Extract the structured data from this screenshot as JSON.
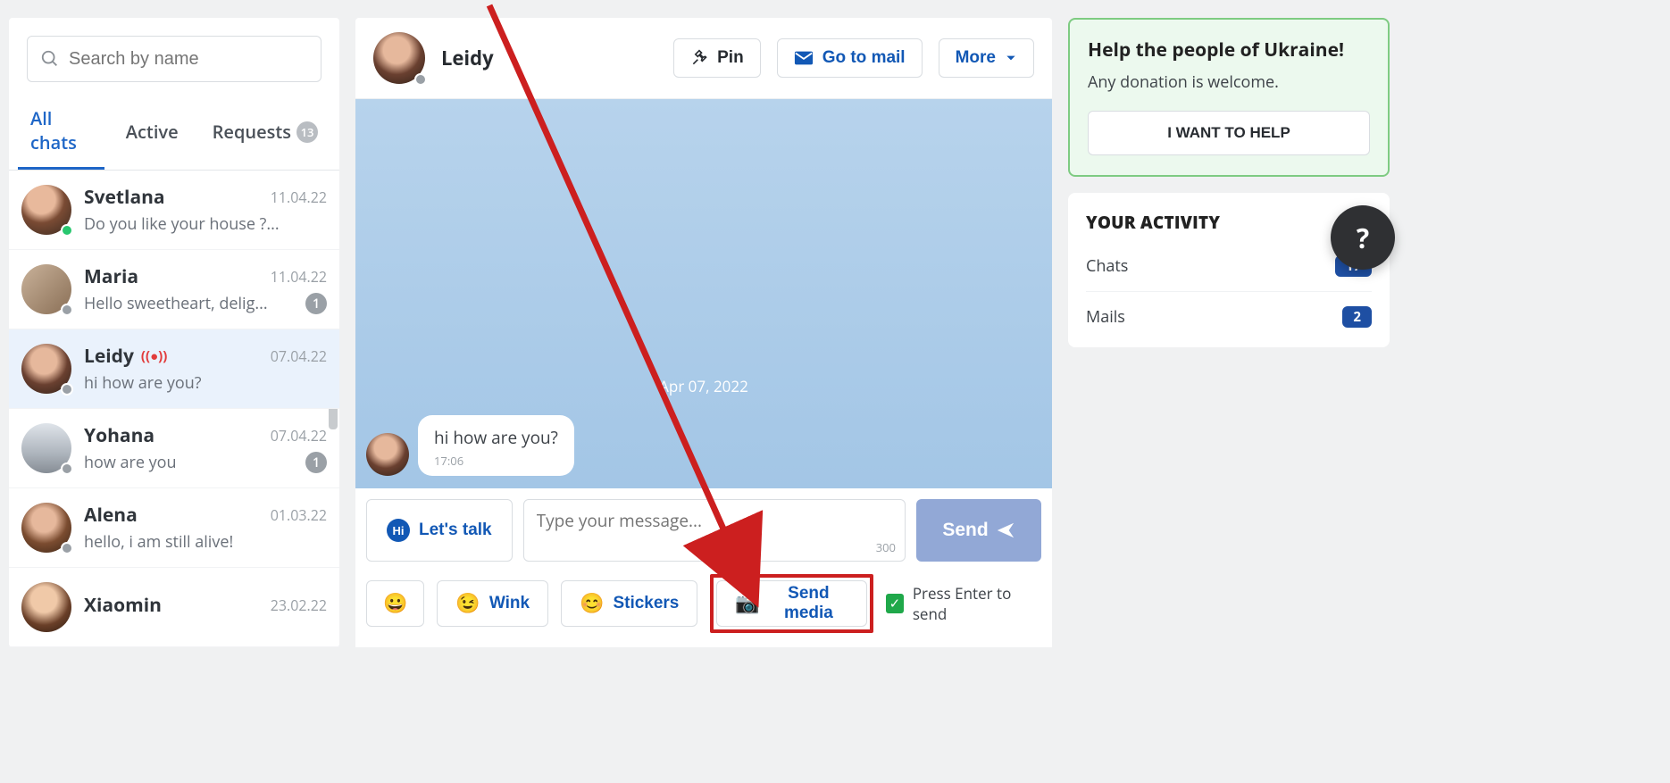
{
  "sidebar": {
    "search_placeholder": "Search by name",
    "tabs": {
      "all": "All chats",
      "active": "Active",
      "requests": "Requests",
      "requests_count": "13"
    },
    "items": [
      {
        "name": "Svetlana",
        "date": "11.04.22",
        "preview": "Do you like your house ?...",
        "status": "online",
        "badge": "",
        "live": false
      },
      {
        "name": "Maria",
        "date": "11.04.22",
        "preview": "Hello sweetheart, delig...",
        "status": "offline",
        "badge": "1",
        "live": false
      },
      {
        "name": "Leidy",
        "date": "07.04.22",
        "preview": "hi how are you?",
        "status": "offline",
        "badge": "",
        "live": true
      },
      {
        "name": "Yohana",
        "date": "07.04.22",
        "preview": "how are you",
        "status": "offline",
        "badge": "1",
        "live": false
      },
      {
        "name": "Alena",
        "date": "01.03.22",
        "preview": "hello, i am still alive!",
        "status": "offline",
        "badge": "",
        "live": false
      },
      {
        "name": "Xiaomin",
        "date": "23.02.22",
        "preview": "",
        "status": "offline",
        "badge": "",
        "live": false
      }
    ]
  },
  "chat": {
    "name": "Leidy",
    "buttons": {
      "pin": "Pin",
      "mail": "Go to mail",
      "more": "More"
    },
    "date_divider": "Apr 07, 2022",
    "message": {
      "text": "hi how are you?",
      "time": "17:06"
    },
    "composer": {
      "placeholder": "Type your message...",
      "count": "300",
      "lets_talk": "Let's talk",
      "send": "Send",
      "wink": "Wink",
      "stickers": "Stickers",
      "send_media": "Send media",
      "press_enter": "Press Enter to send"
    }
  },
  "right": {
    "ukraine": {
      "title": "Help the people of Ukraine!",
      "text": "Any donation is welcome.",
      "button": "I WANT TO HELP"
    },
    "activity": {
      "title": "YOUR ACTIVITY",
      "chats_label": "Chats",
      "chats_count": "17",
      "mails_label": "Mails",
      "mails_count": "2"
    },
    "help": "?"
  }
}
